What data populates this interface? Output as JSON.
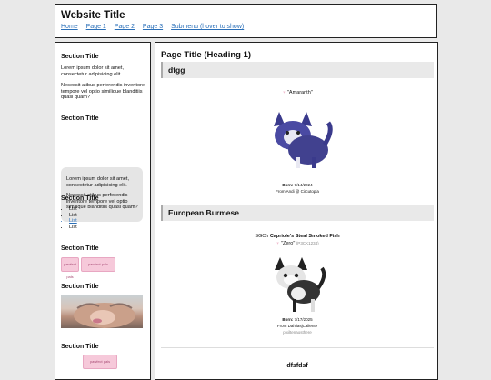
{
  "header": {
    "title": "Website Title",
    "nav": [
      "Home",
      "Page 1",
      "Page 2",
      "Page 3",
      "Submenu (hover to show)"
    ]
  },
  "sidebar": {
    "s1": {
      "title": "Section Title",
      "p1": "Lorem ipsum dolor sit amet, consectetur adipisicing elit.",
      "p2": "Necessit atibus perferendis inventore tempore vel optio similique blanditiis quasi quam?"
    },
    "s2": {
      "title": "Section Title",
      "p1": "Lorem ipsum dolor sit amet, consectetur adipisicing elit.",
      "p2": "Necessit atibus perferendis inventore tempore vel optio similique blanditiis quasi quam?"
    },
    "s3": {
      "title": "Section Title",
      "list": [
        "List",
        "List",
        "List",
        "List"
      ]
    },
    "s4": {
      "title": "Section Title",
      "badges": [
        "pawfect pals",
        "pawfect pals"
      ]
    },
    "s5": {
      "title": "Section Title"
    },
    "s6": {
      "title": "Section Title",
      "badges": [
        "pawfect pals"
      ]
    }
  },
  "main": {
    "page_title": "Page Title (Heading 1)",
    "section1": {
      "heading": "dfgg",
      "pet_name": "\"Amaranth\"",
      "born_label": "Born:",
      "born_date": "9/14/2024",
      "from": "From Andi @ Circutopia"
    },
    "section2": {
      "heading": "European Burmese",
      "prefix": "SGCh",
      "full_name": "Capriole's Steal Smoked Fish",
      "pet_name": "\"Zero\"",
      "id": "(P3CK1234)",
      "born_label": "Born:",
      "born_date": "7/17/2025",
      "from": "From DahliasjCaliente",
      "extra": "pixiltenaosthere"
    },
    "section3": {
      "heading": "dfsfdsf"
    }
  }
}
